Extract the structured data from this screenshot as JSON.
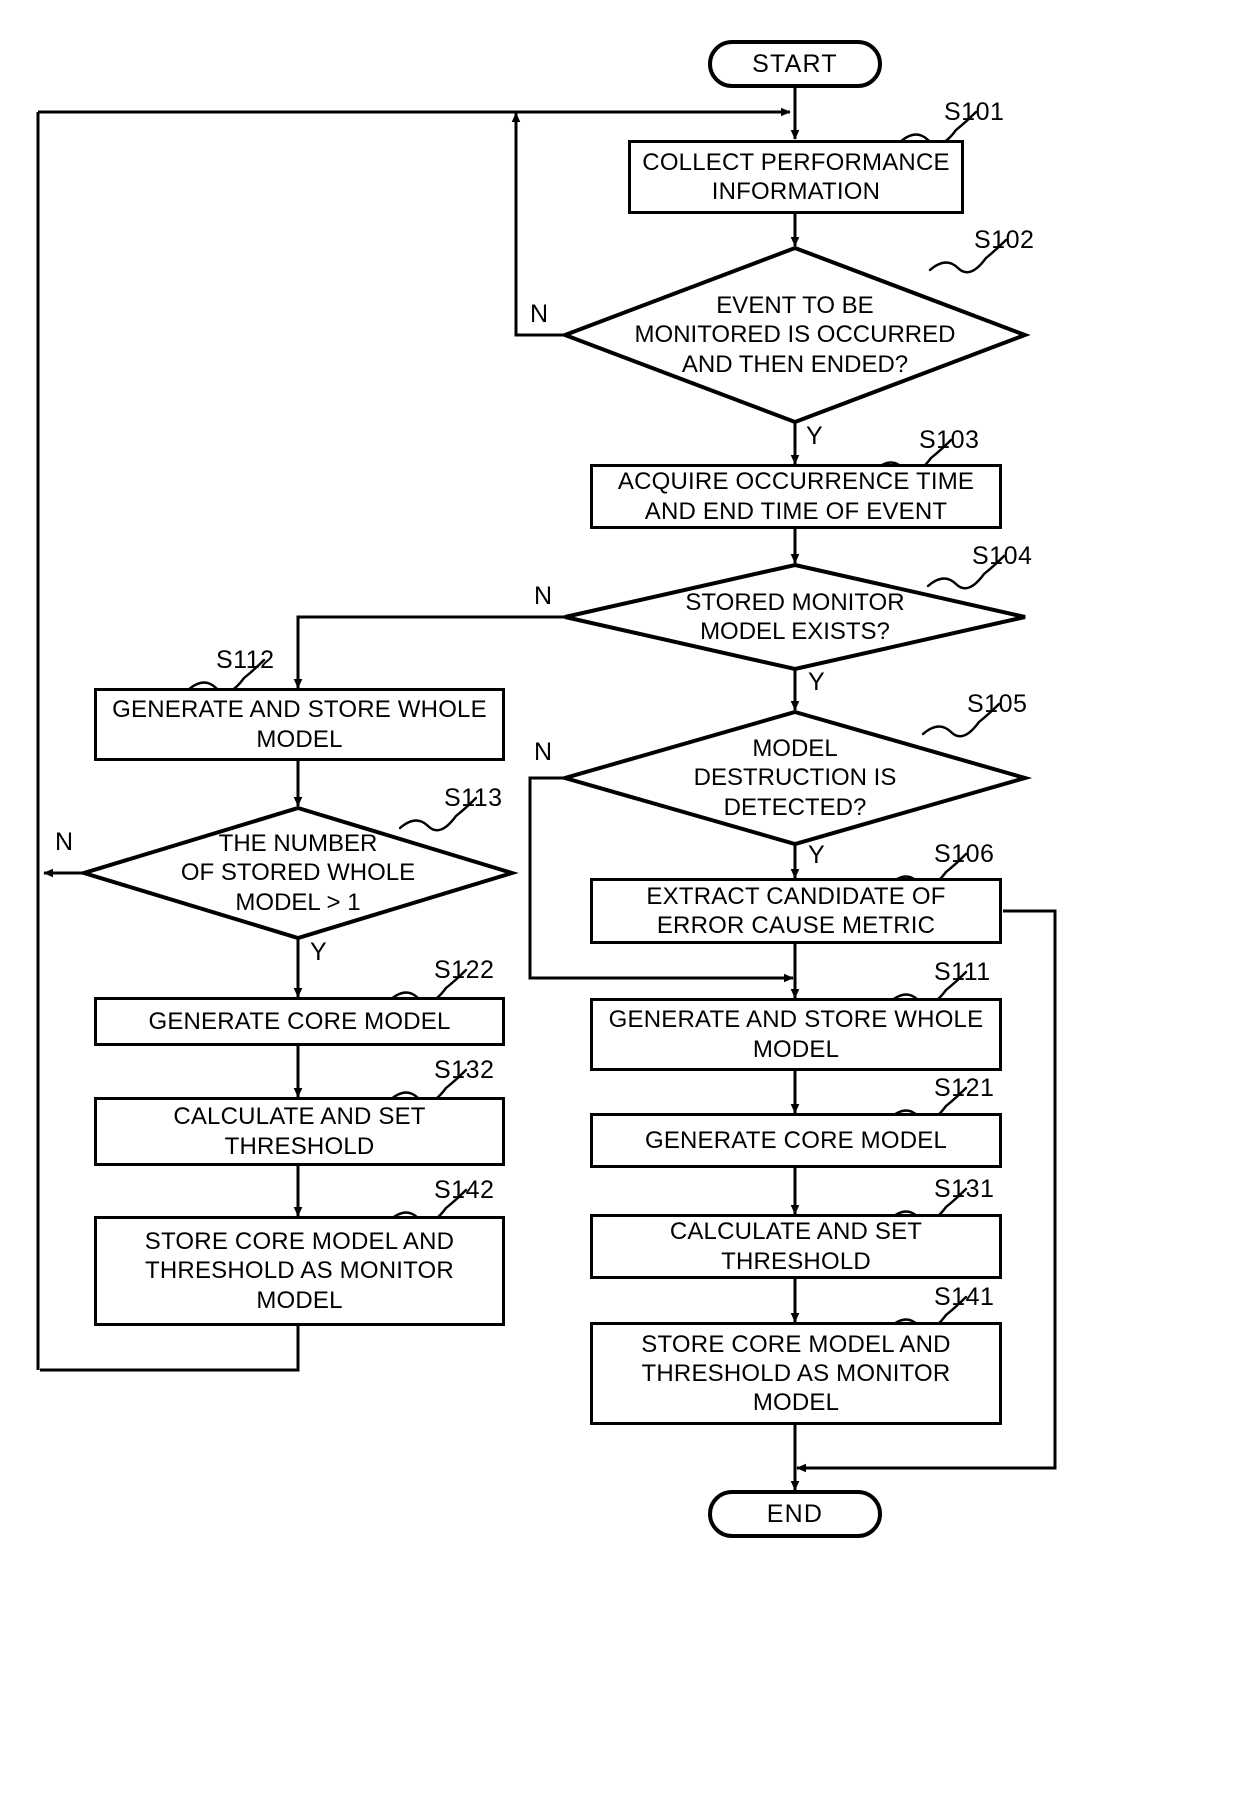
{
  "diagram": {
    "title": "Monitor model generation flowchart",
    "stroke_color": "#000000",
    "background_color": "#ffffff"
  },
  "terminators": {
    "start": "START",
    "end": "END"
  },
  "nodes": [
    {
      "id": "s101",
      "shape": "process",
      "text": "COLLECT PERFORMANCE\nINFORMATION",
      "step": "S101"
    },
    {
      "id": "s102",
      "shape": "decision",
      "text": "EVENT TO BE\nMONITORED IS OCCURRED\nAND THEN ENDED?",
      "step": "S102"
    },
    {
      "id": "s103",
      "shape": "process",
      "text": "ACQUIRE OCCURRENCE TIME\nAND END TIME OF EVENT",
      "step": "S103"
    },
    {
      "id": "s104",
      "shape": "decision",
      "text": "STORED MONITOR\nMODEL EXISTS?",
      "step": "S104"
    },
    {
      "id": "s105",
      "shape": "decision",
      "text": "MODEL\nDESTRUCTION IS\nDETECTED?",
      "step": "S105"
    },
    {
      "id": "s106",
      "shape": "process",
      "text": "EXTRACT CANDIDATE OF\nERROR CAUSE METRIC",
      "step": "S106"
    },
    {
      "id": "s111",
      "shape": "process",
      "text": "GENERATE AND STORE WHOLE\nMODEL",
      "step": "S111"
    },
    {
      "id": "s121",
      "shape": "process",
      "text": "GENERATE CORE MODEL",
      "step": "S121"
    },
    {
      "id": "s131",
      "shape": "process",
      "text": "CALCULATE AND SET\nTHRESHOLD",
      "step": "S131"
    },
    {
      "id": "s141",
      "shape": "process",
      "text": "STORE CORE MODEL AND\nTHRESHOLD AS MONITOR\nMODEL",
      "step": "S141"
    },
    {
      "id": "s112",
      "shape": "process",
      "text": "GENERATE AND STORE WHOLE\nMODEL",
      "step": "S112"
    },
    {
      "id": "s113",
      "shape": "decision",
      "text": "THE NUMBER\nOF STORED WHOLE\nMODEL > 1",
      "step": "S113"
    },
    {
      "id": "s122",
      "shape": "process",
      "text": "GENERATE CORE MODEL",
      "step": "S122"
    },
    {
      "id": "s132",
      "shape": "process",
      "text": "CALCULATE AND SET\nTHRESHOLD",
      "step": "S132"
    },
    {
      "id": "s142",
      "shape": "process",
      "text": "STORE CORE MODEL AND\nTHRESHOLD AS MONITOR\nMODEL",
      "step": "S142"
    }
  ],
  "branch_labels": {
    "s102_no": "N",
    "s102_yes": "Y",
    "s104_no": "N",
    "s104_yes": "Y",
    "s105_no": "N",
    "s105_yes": "Y",
    "s113_no": "N",
    "s113_yes": "Y"
  },
  "step_labels": {
    "s101": "S101",
    "s102": "S102",
    "s103": "S103",
    "s104": "S104",
    "s105": "S105",
    "s106": "S106",
    "s111": "S111",
    "s121": "S121",
    "s131": "S131",
    "s141": "S141",
    "s112": "S112",
    "s113": "S113",
    "s122": "S122",
    "s132": "S132",
    "s142": "S142"
  },
  "node_text": {
    "s101": "COLLECT PERFORMANCE\nINFORMATION",
    "s102": "EVENT TO BE\nMONITORED IS OCCURRED\nAND THEN ENDED?",
    "s103": "ACQUIRE OCCURRENCE TIME\nAND END TIME OF EVENT",
    "s104": "STORED MONITOR\nMODEL EXISTS?",
    "s105": "MODEL\nDESTRUCTION IS\nDETECTED?",
    "s106": "EXTRACT CANDIDATE OF\nERROR CAUSE METRIC",
    "s111": "GENERATE AND STORE WHOLE\nMODEL",
    "s121": "GENERATE CORE MODEL",
    "s131": "CALCULATE AND SET\nTHRESHOLD",
    "s141": "STORE CORE MODEL AND\nTHRESHOLD AS MONITOR\nMODEL",
    "s112": "GENERATE AND STORE WHOLE\nMODEL",
    "s113": "THE NUMBER\nOF STORED WHOLE\nMODEL > 1",
    "s122": "GENERATE CORE MODEL",
    "s132": "CALCULATE AND SET\nTHRESHOLD",
    "s142": "STORE CORE MODEL AND\nTHRESHOLD AS MONITOR\nMODEL"
  }
}
